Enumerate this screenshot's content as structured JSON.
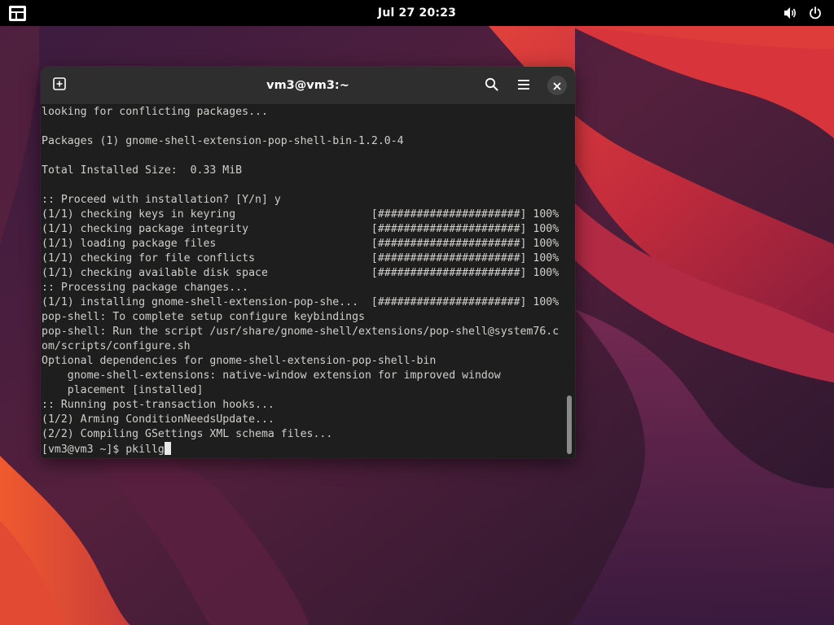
{
  "topbar": {
    "clock": "Jul 27  20:23",
    "icons": [
      "activities-icon",
      "volume-icon",
      "power-icon"
    ]
  },
  "window": {
    "title": "vm3@vm3:~",
    "icons": [
      "new-tab-icon",
      "search-icon",
      "hamburger-menu-icon",
      "close-icon"
    ]
  },
  "terminal": {
    "lines": [
      "looking for conflicting packages...",
      "",
      "Packages (1) gnome-shell-extension-pop-shell-bin-1.2.0-4",
      "",
      "Total Installed Size:  0.33 MiB",
      "",
      ":: Proceed with installation? [Y/n] y",
      "(1/1) checking keys in keyring                     [######################] 100%",
      "(1/1) checking package integrity                   [######################] 100%",
      "(1/1) loading package files                        [######################] 100%",
      "(1/1) checking for file conflicts                  [######################] 100%",
      "(1/1) checking available disk space                [######################] 100%",
      ":: Processing package changes...",
      "(1/1) installing gnome-shell-extension-pop-she...  [######################] 100%",
      "pop-shell: To complete setup configure keybindings",
      "pop-shell: Run the script /usr/share/gnome-shell/extensions/pop-shell@system76.c",
      "om/scripts/configure.sh",
      "Optional dependencies for gnome-shell-extension-pop-shell-bin",
      "    gnome-shell-extensions: native-window extension for improved window",
      "    placement [installed]",
      ":: Running post-transaction hooks...",
      "(1/2) Arming ConditionNeedsUpdate...",
      "(2/2) Compiling GSettings XML schema files..."
    ],
    "prompt": "[vm3@vm3 ~]$ ",
    "command_input": "pkillg"
  },
  "colors": {
    "topbar": "#000000",
    "headerbar": "#2e2e2e",
    "terminal_bg": "#1e1e1e",
    "terminal_fg": "#d0cfcc"
  }
}
